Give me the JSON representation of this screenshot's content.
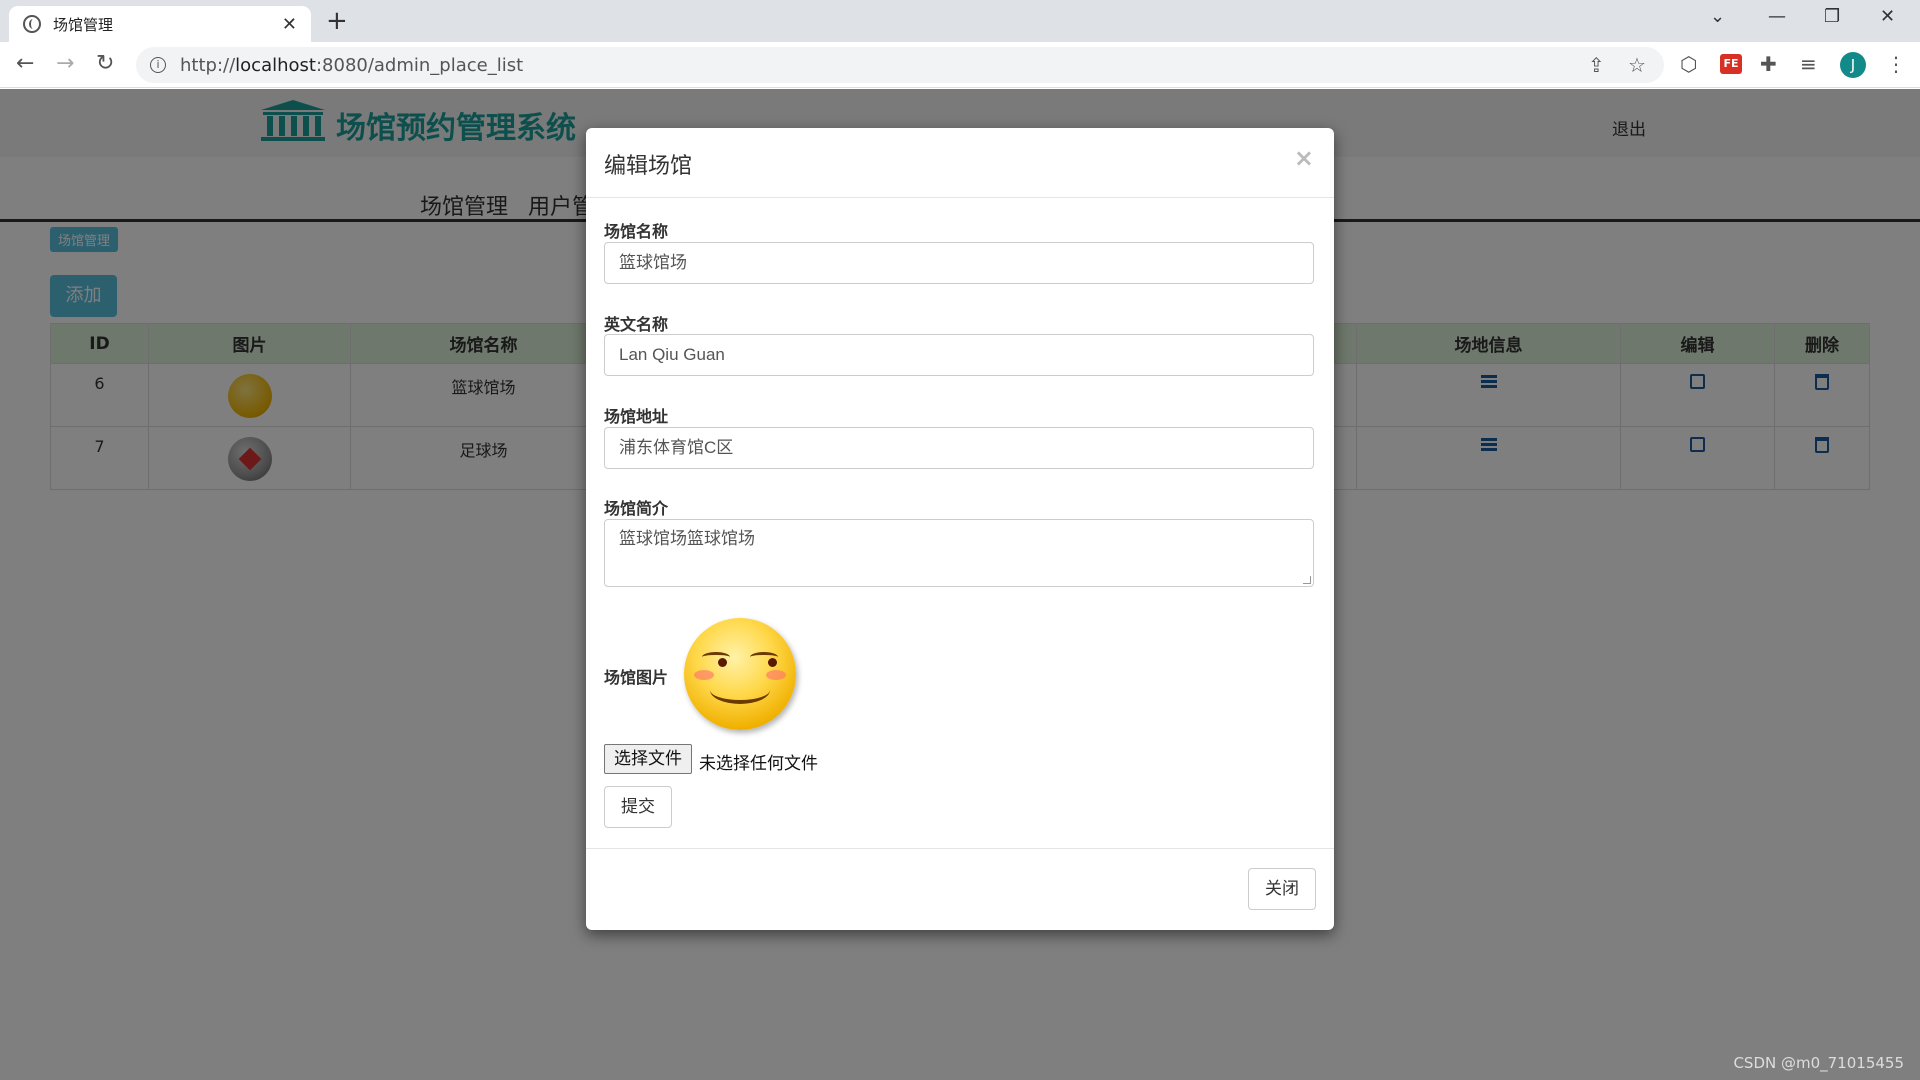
{
  "browser": {
    "tab_title": "场馆管理",
    "url_prefix": "http://",
    "url_host": "localhost",
    "url_rest": ":8080/admin_place_list",
    "avatar_letter": "J",
    "ext_label": "FE"
  },
  "app": {
    "brand": "场馆预约管理系统",
    "logout": "退出",
    "menu": [
      "场馆管理",
      "用户管"
    ],
    "breadcrumb": "场馆管理",
    "add_button": "添加"
  },
  "table": {
    "headers": [
      "ID",
      "图片",
      "场馆名称",
      "场地信息",
      "编辑",
      "删除"
    ],
    "rows": [
      {
        "id": "6",
        "name": "篮球馆场"
      },
      {
        "id": "7",
        "name": "足球场"
      }
    ]
  },
  "modal": {
    "title": "编辑场馆",
    "close_x": "×",
    "fields": {
      "name_label": "场馆名称",
      "name_value": "篮球馆场",
      "en_label": "英文名称",
      "en_value": "Lan Qiu Guan",
      "addr_label": "场馆地址",
      "addr_value": "浦东体育馆C区",
      "intro_label": "场馆简介",
      "intro_value": "篮球馆场篮球馆场",
      "img_label": "场馆图片"
    },
    "file_button": "选择文件",
    "file_status": "未选择任何文件",
    "submit": "提交",
    "close": "关闭"
  },
  "watermark": "CSDN @m0_71015455"
}
